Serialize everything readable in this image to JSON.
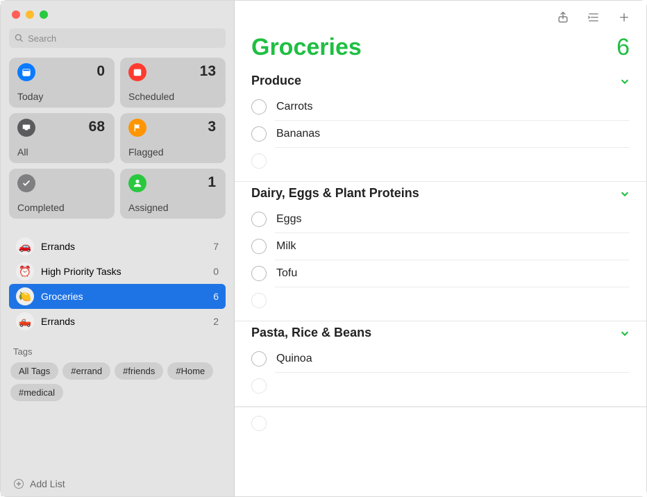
{
  "sidebar": {
    "search_placeholder": "Search",
    "smart_lists": [
      {
        "key": "today",
        "label": "Today",
        "count": 0,
        "icon": "calendar-today",
        "color": "#0a7aff"
      },
      {
        "key": "scheduled",
        "label": "Scheduled",
        "count": 13,
        "icon": "calendar",
        "color": "#ff3b30"
      },
      {
        "key": "all",
        "label": "All",
        "count": 68,
        "icon": "tray",
        "color": "#5b5b5e"
      },
      {
        "key": "flagged",
        "label": "Flagged",
        "count": 3,
        "icon": "flag",
        "color": "#ff9500"
      },
      {
        "key": "completed",
        "label": "Completed",
        "count": "",
        "icon": "check",
        "color": "#7f7f82"
      },
      {
        "key": "assigned",
        "label": "Assigned",
        "count": 1,
        "icon": "person",
        "color": "#29c840"
      }
    ],
    "user_lists": [
      {
        "label": "Errands",
        "count": 7,
        "emoji": "🚗",
        "selected": false
      },
      {
        "label": "High Priority Tasks",
        "count": 0,
        "emoji": "⏰",
        "selected": false
      },
      {
        "label": "Groceries",
        "count": 6,
        "emoji": "🍋",
        "selected": true
      },
      {
        "label": "Errands",
        "count": 2,
        "emoji": "🛻",
        "selected": false
      }
    ],
    "tags_header": "Tags",
    "tags": [
      "All Tags",
      "#errand",
      "#friends",
      "#Home",
      "#medical"
    ],
    "add_list_label": "Add List"
  },
  "list": {
    "title": "Groceries",
    "count": 6,
    "accent": "#1fbf43",
    "sections": [
      {
        "title": "Produce",
        "items": [
          {
            "label": "Carrots"
          },
          {
            "label": "Bananas"
          }
        ]
      },
      {
        "title": "Dairy, Eggs & Plant Proteins",
        "items": [
          {
            "label": "Eggs"
          },
          {
            "label": "Milk"
          },
          {
            "label": "Tofu"
          }
        ]
      },
      {
        "title": "Pasta, Rice & Beans",
        "items": [
          {
            "label": "Quinoa"
          }
        ]
      }
    ]
  }
}
